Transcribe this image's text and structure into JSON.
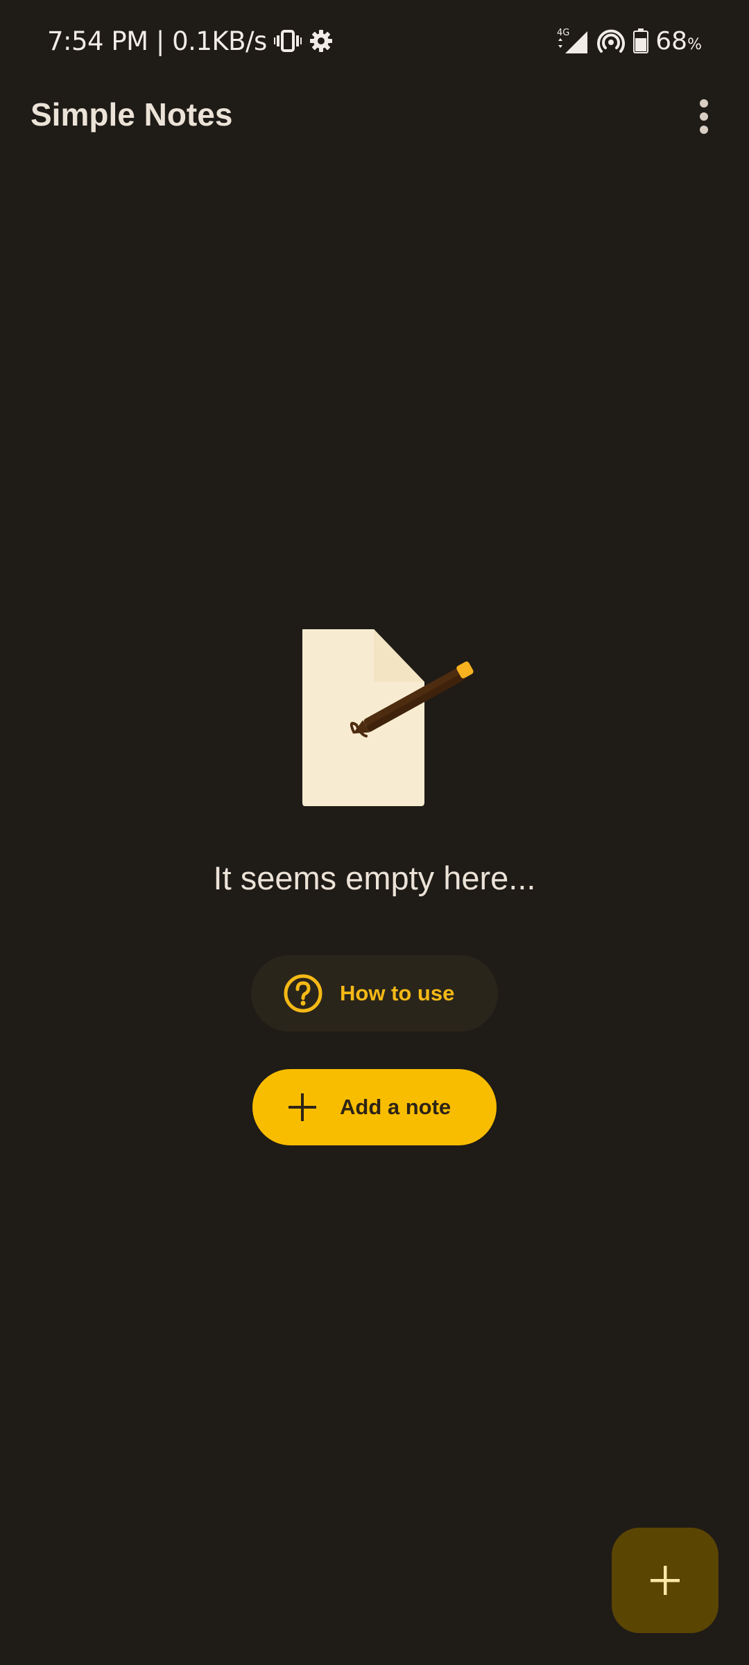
{
  "status_bar": {
    "time_speed": "7:54 PM | 0.1KB/s",
    "network_label": "4G",
    "battery_value": "68",
    "battery_unit": "%"
  },
  "app_bar": {
    "title": "Simple Notes"
  },
  "empty_state": {
    "message": "It seems empty here...",
    "how_to_use_label": "How to use",
    "add_note_label": "Add a note"
  },
  "colors": {
    "background": "#1f1b17",
    "accent": "#f9bd00",
    "fab": "#5a4503",
    "text": "#ece3d8"
  },
  "icons": {
    "vibrate": "vibrate-icon",
    "settings": "gear-icon",
    "signal": "signal-icon",
    "hotspot": "hotspot-icon",
    "battery": "battery-icon",
    "menu": "more-vert-icon",
    "help": "help-circle-icon",
    "add": "plus-icon"
  }
}
